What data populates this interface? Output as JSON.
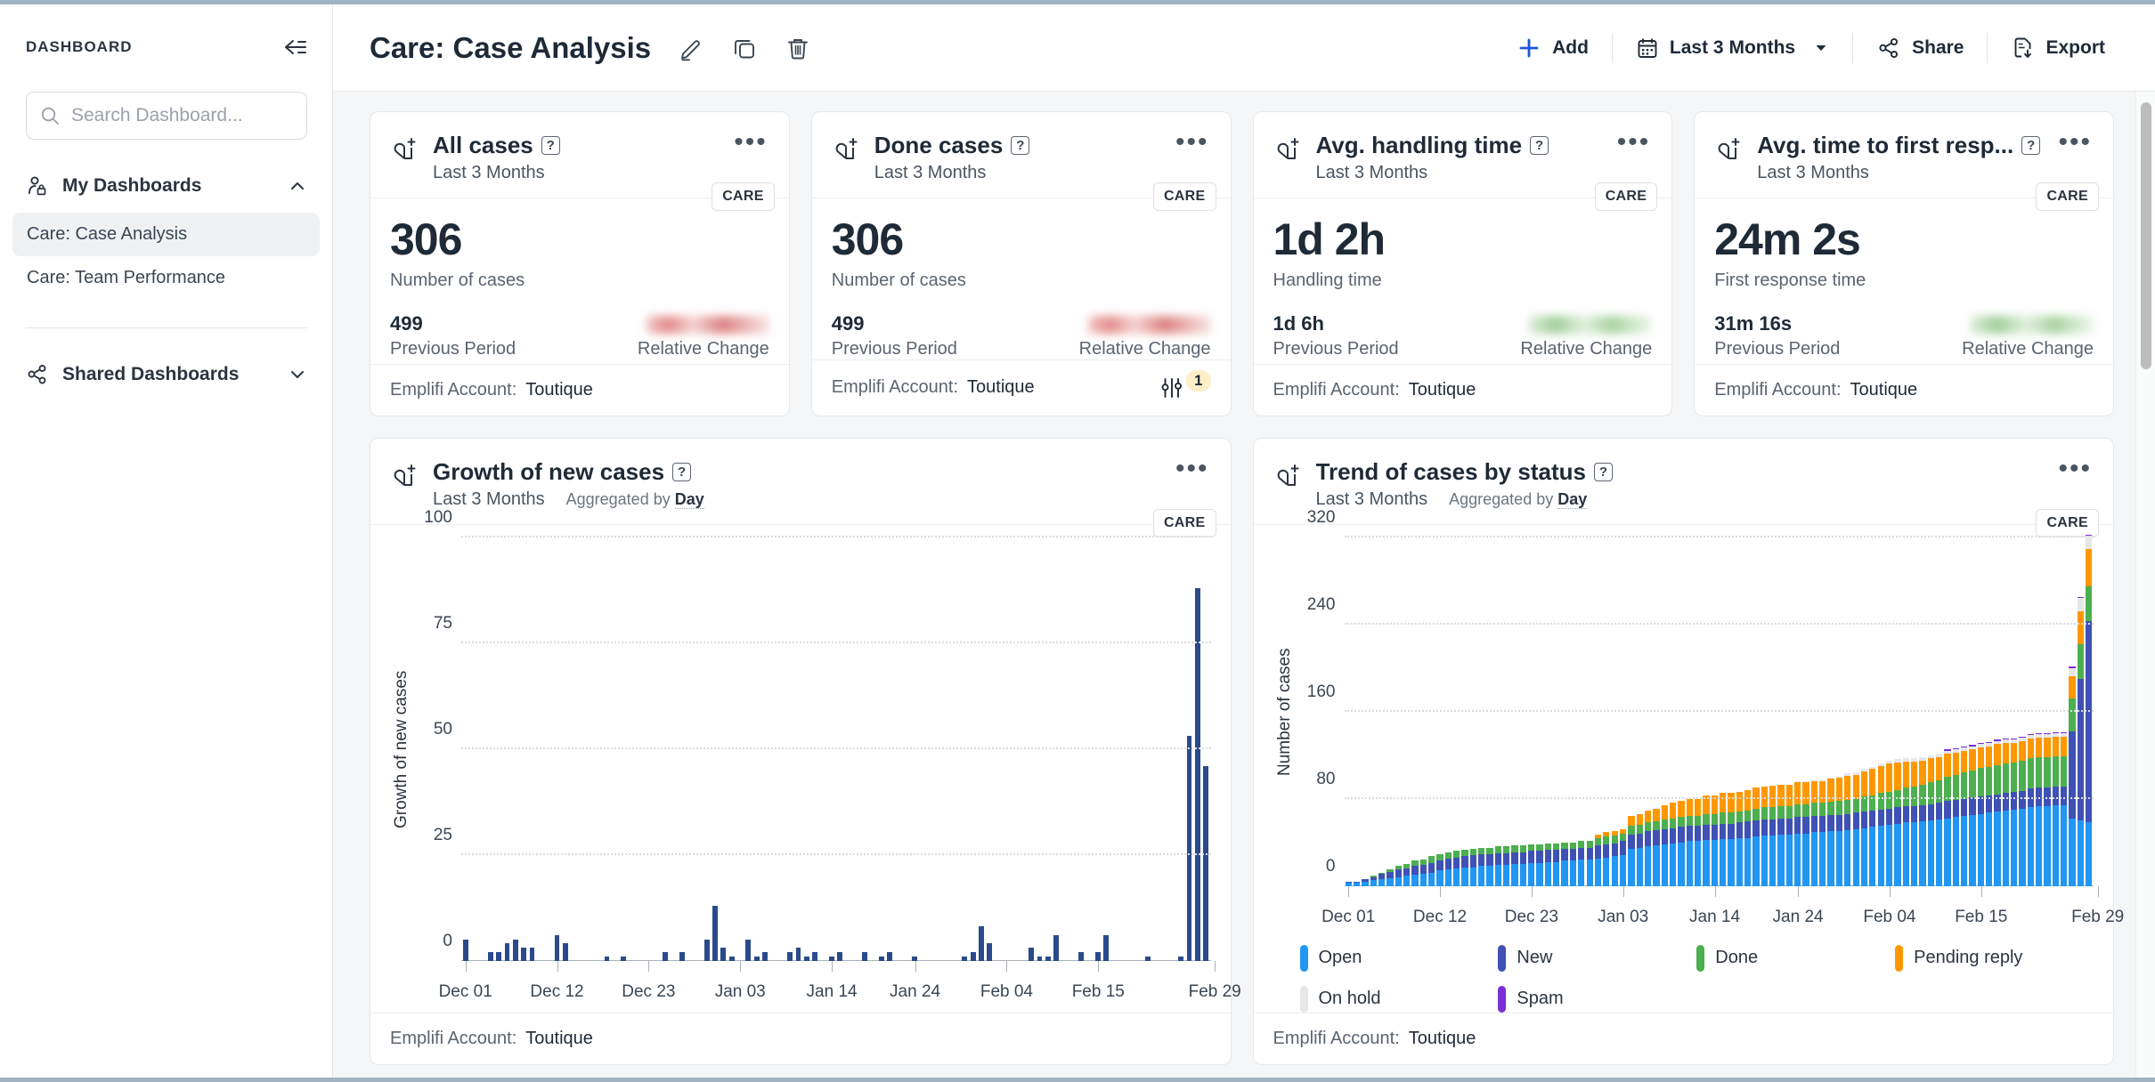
{
  "sidebar": {
    "title": "DASHBOARD",
    "collapse_icon": "collapse-left-icon",
    "search": {
      "placeholder": "Search Dashboard...",
      "value": "",
      "icon": "search-icon"
    },
    "groups": [
      {
        "label": "My Dashboards",
        "icon": "user-lock-icon",
        "chevron": "chevron-up-icon",
        "expanded": true,
        "items": [
          {
            "label": "Care: Case Analysis",
            "active": true
          },
          {
            "label": "Care: Team Performance",
            "active": false
          }
        ]
      },
      {
        "label": "Shared Dashboards",
        "icon": "share-nodes-icon",
        "chevron": "chevron-down-icon",
        "expanded": false,
        "items": []
      }
    ]
  },
  "topbar": {
    "title": "Care: Case Analysis",
    "edit_icon": "pencil-icon",
    "duplicate_icon": "copy-icon",
    "delete_icon": "trash-icon",
    "add_label": "Add",
    "add_icon": "plus-icon",
    "date_range_label": "Last 3 Months",
    "date_range_icon": "calendar-icon",
    "date_range_chevron": "caret-down-icon",
    "share_label": "Share",
    "share_icon": "share-nodes-icon",
    "export_label": "Export",
    "export_icon": "file-download-icon",
    "accent_color": "#1a56db"
  },
  "kpi_cards": [
    {
      "title": "All cases",
      "subtitle": "Last 3 Months",
      "badge": "CARE",
      "value": "306",
      "unit": "Number of cases",
      "previous_value": "499",
      "previous_label": "Previous Period",
      "relative_label": "Relative Change",
      "relative_redacted": true,
      "relative_tone": "neg",
      "footer_label": "Emplifi Account:",
      "footer_value": "Toutique",
      "filter_count": null,
      "icon": "heart-plus-icon",
      "help_icon": "help-icon",
      "menu_icon": "kebab-menu-icon"
    },
    {
      "title": "Done cases",
      "subtitle": "Last 3 Months",
      "badge": "CARE",
      "value": "306",
      "unit": "Number of cases",
      "previous_value": "499",
      "previous_label": "Previous Period",
      "relative_label": "Relative Change",
      "relative_redacted": true,
      "relative_tone": "neg",
      "footer_label": "Emplifi Account:",
      "footer_value": "Toutique",
      "filter_count": "1",
      "icon": "heart-plus-icon",
      "help_icon": "help-icon",
      "menu_icon": "kebab-menu-icon"
    },
    {
      "title": "Avg. handling time",
      "subtitle": "Last 3 Months",
      "badge": "CARE",
      "value": "1d 2h",
      "unit": "Handling time",
      "previous_value": "1d 6h",
      "previous_label": "Previous Period",
      "relative_label": "Relative Change",
      "relative_redacted": true,
      "relative_tone": "pos",
      "footer_label": "Emplifi Account:",
      "footer_value": "Toutique",
      "filter_count": null,
      "icon": "heart-plus-icon",
      "help_icon": "help-icon",
      "menu_icon": "kebab-menu-icon"
    },
    {
      "title": "Avg. time to first resp...",
      "subtitle": "Last 3 Months",
      "badge": "CARE",
      "value": "24m 2s",
      "unit": "First response time",
      "previous_value": "31m 16s",
      "previous_label": "Previous Period",
      "relative_label": "Relative Change",
      "relative_redacted": true,
      "relative_tone": "pos",
      "footer_label": "Emplifi Account:",
      "footer_value": "Toutique",
      "filter_count": null,
      "icon": "heart-plus-icon",
      "help_icon": "help-icon",
      "menu_icon": "kebab-menu-icon"
    }
  ],
  "chart_cards": [
    {
      "title": "Growth of new cases",
      "subtitle": "Last 3 Months",
      "aggregation_prefix": "Aggregated by",
      "aggregation_value": "Day",
      "badge": "CARE",
      "footer_label": "Emplifi Account:",
      "footer_value": "Toutique",
      "icon": "heart-plus-icon",
      "help_icon": "help-icon",
      "menu_icon": "kebab-menu-icon"
    },
    {
      "title": "Trend of cases by status",
      "subtitle": "Last 3 Months",
      "aggregation_prefix": "Aggregated by",
      "aggregation_value": "Day",
      "badge": "CARE",
      "footer_label": "Emplifi Account:",
      "footer_value": "Toutique",
      "icon": "heart-plus-icon",
      "help_icon": "help-icon",
      "menu_icon": "kebab-menu-icon"
    }
  ],
  "chart_data": [
    {
      "type": "bar",
      "title": "Growth of new cases",
      "xlabel": "",
      "ylabel": "Growth of new cases",
      "ylim": [
        0,
        100
      ],
      "yticks": [
        0,
        25,
        50,
        75,
        100
      ],
      "grid": true,
      "legend": "none",
      "bar_color": "#2a4a8b",
      "xtick_labels": [
        "Dec 01",
        "Dec 12",
        "Dec 23",
        "Jan 03",
        "Jan 14",
        "Jan 24",
        "Feb 04",
        "Feb 15",
        "Feb 29"
      ],
      "xtick_indices": [
        0,
        11,
        22,
        33,
        44,
        54,
        65,
        76,
        90
      ],
      "values": [
        5,
        0,
        0,
        2,
        2,
        4,
        5,
        3,
        3,
        0,
        0,
        6,
        4,
        0,
        0,
        0,
        0,
        1,
        0,
        1,
        0,
        0,
        0,
        0,
        2,
        0,
        2,
        0,
        0,
        5,
        13,
        3,
        1,
        0,
        5,
        1,
        2,
        0,
        0,
        2,
        3,
        1,
        2,
        0,
        1,
        2,
        0,
        0,
        2,
        0,
        1,
        2,
        0,
        0,
        1,
        0,
        0,
        0,
        0,
        0,
        1,
        2,
        8,
        4,
        0,
        0,
        0,
        0,
        3,
        1,
        1,
        6,
        0,
        0,
        2,
        0,
        2,
        6,
        0,
        0,
        0,
        0,
        1,
        0,
        0,
        0,
        1,
        53,
        88,
        46
      ]
    },
    {
      "type": "bar",
      "stacked": true,
      "title": "Trend of cases by status",
      "xlabel": "",
      "ylabel": "Number of cases",
      "ylim": [
        0,
        320
      ],
      "yticks": [
        0,
        80,
        160,
        240,
        320
      ],
      "grid": true,
      "legend": "bottom",
      "xtick_labels": [
        "Dec 01",
        "Dec 12",
        "Dec 23",
        "Jan 03",
        "Jan 14",
        "Jan 24",
        "Feb 04",
        "Feb 15",
        "Feb 29"
      ],
      "xtick_indices": [
        0,
        11,
        22,
        33,
        44,
        54,
        65,
        76,
        90
      ],
      "series": [
        {
          "name": "Open",
          "color": "#2196f3",
          "values": [
            3,
            3,
            4,
            5,
            6,
            7,
            8,
            9,
            10,
            11,
            12,
            14,
            15,
            16,
            17,
            17,
            18,
            18,
            19,
            19,
            20,
            20,
            21,
            21,
            22,
            22,
            23,
            23,
            24,
            24,
            25,
            26,
            27,
            28,
            34,
            35,
            36,
            37,
            38,
            39,
            40,
            41,
            41,
            42,
            42,
            43,
            43,
            44,
            44,
            45,
            46,
            46,
            47,
            47,
            48,
            48,
            49,
            49,
            50,
            50,
            51,
            52,
            53,
            54,
            55,
            56,
            57,
            58,
            58,
            59,
            60,
            61,
            62,
            63,
            64,
            65,
            66,
            67,
            68,
            69,
            70,
            71,
            72,
            73,
            73,
            74,
            74,
            62,
            60,
            58
          ]
        },
        {
          "name": "New",
          "color": "#3f51b5",
          "values": [
            1,
            1,
            2,
            3,
            5,
            6,
            7,
            7,
            8,
            8,
            9,
            9,
            10,
            10,
            10,
            11,
            11,
            11,
            11,
            11,
            11,
            11,
            11,
            11,
            11,
            11,
            11,
            11,
            11,
            11,
            12,
            12,
            12,
            13,
            13,
            13,
            14,
            14,
            14,
            14,
            14,
            14,
            14,
            14,
            14,
            14,
            14,
            14,
            15,
            15,
            15,
            15,
            15,
            15,
            15,
            15,
            15,
            15,
            15,
            15,
            15,
            15,
            15,
            15,
            15,
            15,
            15,
            15,
            15,
            15,
            15,
            15,
            16,
            16,
            16,
            16,
            16,
            16,
            16,
            16,
            16,
            16,
            17,
            17,
            17,
            17,
            17,
            80,
            130,
            185
          ]
        },
        {
          "name": "Done",
          "color": "#4caf50",
          "values": [
            0,
            0,
            0,
            1,
            1,
            2,
            3,
            4,
            5,
            5,
            6,
            6,
            6,
            6,
            6,
            6,
            6,
            6,
            6,
            6,
            6,
            6,
            6,
            6,
            6,
            6,
            6,
            6,
            6,
            6,
            7,
            7,
            7,
            7,
            8,
            8,
            8,
            8,
            9,
            9,
            9,
            9,
            9,
            10,
            10,
            10,
            10,
            10,
            10,
            11,
            11,
            11,
            11,
            11,
            12,
            12,
            12,
            12,
            12,
            13,
            13,
            13,
            14,
            14,
            15,
            15,
            16,
            17,
            18,
            19,
            20,
            21,
            22,
            23,
            24,
            25,
            26,
            26,
            27,
            27,
            27,
            28,
            28,
            28,
            28,
            28,
            28,
            30,
            32,
            32
          ]
        },
        {
          "name": "Pending reply",
          "color": "#ff9800",
          "values": [
            0,
            0,
            0,
            0,
            0,
            0,
            0,
            0,
            0,
            0,
            0,
            0,
            0,
            0,
            0,
            0,
            0,
            0,
            0,
            0,
            0,
            0,
            0,
            0,
            0,
            0,
            0,
            0,
            0,
            0,
            3,
            4,
            4,
            4,
            9,
            10,
            11,
            12,
            13,
            14,
            15,
            16,
            16,
            17,
            17,
            18,
            18,
            18,
            19,
            19,
            19,
            20,
            20,
            20,
            20,
            20,
            20,
            20,
            21,
            21,
            22,
            22,
            23,
            24,
            25,
            26,
            25,
            24,
            23,
            22,
            22,
            21,
            21,
            20,
            20,
            19,
            19,
            19,
            19,
            19,
            18,
            18,
            18,
            18,
            18,
            18,
            18,
            20,
            30,
            34
          ]
        },
        {
          "name": "On hold",
          "color": "#e5e7e9",
          "values": [
            0,
            0,
            0,
            0,
            0,
            0,
            0,
            0,
            0,
            0,
            0,
            0,
            0,
            0,
            0,
            0,
            0,
            0,
            0,
            0,
            0,
            0,
            0,
            0,
            0,
            0,
            0,
            0,
            0,
            0,
            0,
            0,
            0,
            0,
            0,
            0,
            0,
            0,
            0,
            0,
            0,
            0,
            0,
            0,
            0,
            0,
            0,
            0,
            0,
            0,
            0,
            0,
            0,
            0,
            1,
            1,
            1,
            1,
            1,
            1,
            2,
            2,
            2,
            2,
            2,
            3,
            3,
            3,
            3,
            3,
            3,
            3,
            3,
            3,
            3,
            3,
            3,
            3,
            3,
            3,
            3,
            3,
            3,
            3,
            3,
            3,
            3,
            8,
            12,
            12
          ]
        },
        {
          "name": "Spam",
          "color": "#7b2fd4",
          "values": [
            0,
            0,
            0,
            0,
            0,
            0,
            0,
            0,
            0,
            0,
            0,
            0,
            0,
            0,
            0,
            0,
            0,
            0,
            0,
            0,
            0,
            0,
            0,
            0,
            0,
            0,
            0,
            0,
            0,
            0,
            0,
            0,
            0,
            0,
            0,
            0,
            0,
            0,
            0,
            0,
            0,
            0,
            0,
            0,
            0,
            0,
            0,
            0,
            0,
            0,
            0,
            0,
            0,
            0,
            0,
            0,
            0,
            0,
            0,
            0,
            0,
            0,
            0,
            0,
            0,
            0,
            0,
            0,
            0,
            0,
            0,
            0,
            1,
            1,
            1,
            1,
            1,
            1,
            1,
            1,
            1,
            1,
            1,
            1,
            1,
            1,
            1,
            1,
            1,
            1
          ]
        }
      ]
    }
  ],
  "legend_items": [
    {
      "label": "Open",
      "color": "#2196f3"
    },
    {
      "label": "New",
      "color": "#3f51b5"
    },
    {
      "label": "Done",
      "color": "#4caf50"
    },
    {
      "label": "Pending reply",
      "color": "#ff9800"
    },
    {
      "label": "On hold",
      "color": "#e5e7e9"
    },
    {
      "label": "Spam",
      "color": "#7b2fd4"
    }
  ]
}
